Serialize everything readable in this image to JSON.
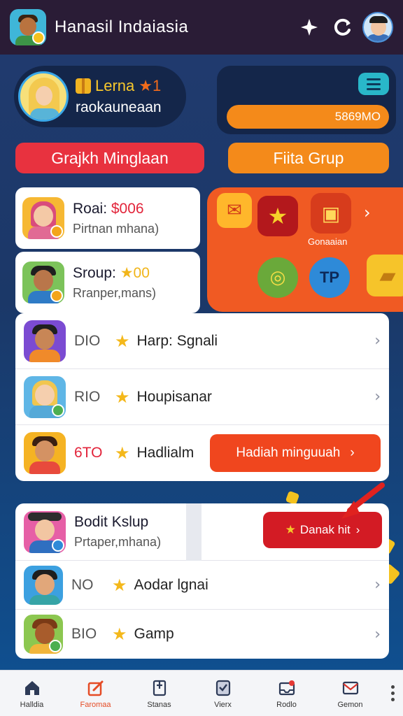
{
  "header": {
    "title": "Hanasil Indaiasia",
    "icons": [
      "sparkle-icon",
      "refresh-icon",
      "user-avatar"
    ]
  },
  "profile": {
    "level_label": "Lerna",
    "level_value": "★1",
    "name": "raokauneaan"
  },
  "balance": {
    "value": "5869MO"
  },
  "actions": {
    "primary": "Grajkh Minglaan",
    "secondary": "Fiita Grup"
  },
  "rewards": {
    "label": "Gonaaian",
    "tp": "TP"
  },
  "top_cards": [
    {
      "title": "Roai:",
      "amount": "$006",
      "subtitle": "Pirtnan mhana)"
    },
    {
      "title": "Sroup:",
      "amount": "★00",
      "subtitle": "Rranper,mans)"
    }
  ],
  "list": [
    {
      "code": "DIO",
      "label": "Harp: Sgnali"
    },
    {
      "code": "RIO",
      "label": "Houpisanar"
    },
    {
      "code": "6TO",
      "label": "Hadlialm",
      "button": "Hadiah minguuah"
    }
  ],
  "bottom_list": {
    "featured": {
      "title": "Bodit Kslup",
      "subtitle": "Prtaper,mhana)",
      "button": "Danak hit"
    },
    "rows": [
      {
        "code": "NO",
        "label": "Aodar lgnai"
      },
      {
        "code": "BIO",
        "label": "Gamp"
      }
    ]
  },
  "nav": {
    "items": [
      {
        "label": "Halldia",
        "icon": "home-icon"
      },
      {
        "label": "Faromaa",
        "icon": "edit-icon",
        "active": true
      },
      {
        "label": "Stanas",
        "icon": "bookmark-icon"
      },
      {
        "label": "Vierx",
        "icon": "shield-icon"
      },
      {
        "label": "Rodlo",
        "icon": "inbox-icon"
      },
      {
        "label": "Gemon",
        "icon": "mail-icon"
      }
    ]
  },
  "colors": {
    "header_bg": "#2a1c36",
    "accent_red": "#e8323f",
    "accent_orange": "#f48a1a",
    "navy": "#14264a"
  }
}
